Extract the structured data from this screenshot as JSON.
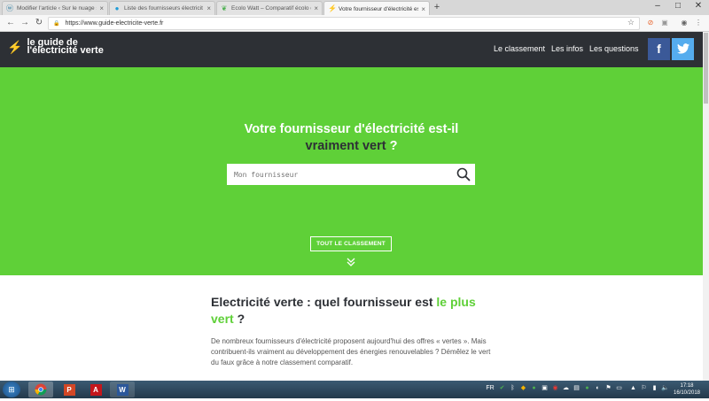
{
  "browser": {
    "tabs": [
      {
        "title": "Modifier l'article ‹ Sur le nuage ›",
        "favicon": "wordpress-icon"
      },
      {
        "title": "Liste des fournisseurs électricit",
        "favicon": "globe-icon"
      },
      {
        "title": "Ecolo Watt – Comparatif écolo d",
        "favicon": "leaf-icon"
      },
      {
        "title": "Votre fournisseur d'électricité es",
        "favicon": "bolt-icon"
      }
    ],
    "url": "https://www.guide-electricite-verte.fr"
  },
  "site": {
    "logo": {
      "line1": "le guide de",
      "line2": "l'électricité verte"
    },
    "nav": [
      {
        "label": "Le classement"
      },
      {
        "label": "Les infos"
      },
      {
        "label": "Les questions"
      }
    ],
    "social": {
      "facebook": "f",
      "twitter": "t"
    },
    "hero": {
      "title_line1": "Votre fournisseur d'électricité est-il",
      "title_line2": "vraiment vert",
      "title_q": " ?",
      "search_placeholder": "Mon fournisseur",
      "cta_label": "TOUT LE CLASSEMENT"
    },
    "intro": {
      "title_part1": "Electricité verte : quel fournisseur est ",
      "title_green": "le plus vert",
      "title_part2": " ?",
      "text": "De nombreux fournisseurs d'électricité proposent aujourd'hui des offres « vertes ». Mais contribuent-ils vraiment au développement des énergies renouvelables ? Démêlez le vert du faux grâce à notre classement comparatif."
    }
  },
  "taskbar": {
    "time": "17:18",
    "date": "16/10/2018",
    "lang": "FR"
  },
  "colors": {
    "green": "#5fd038",
    "dark": "#2d3035",
    "facebook": "#3b5998",
    "twitter": "#55acee"
  }
}
